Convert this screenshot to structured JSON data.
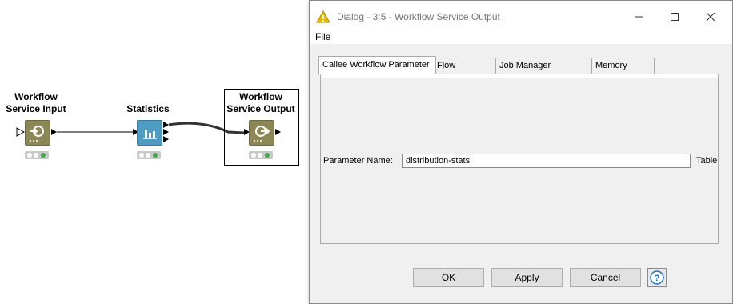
{
  "canvas": {
    "nodes": [
      {
        "title_line1": "Workflow",
        "title_line2": "Service Input",
        "icon": "workflow-input-icon"
      },
      {
        "title_line1": "",
        "title_line2": "Statistics",
        "icon": "statistics-icon"
      },
      {
        "title_line1": "Workflow",
        "title_line2": "Service Output",
        "icon": "workflow-output-icon"
      }
    ]
  },
  "dialog": {
    "title": "Dialog - 3:5 - Workflow Service Output",
    "menu": [
      "File"
    ],
    "tabs": [
      "Callee Workflow Parameter",
      "Flow Variables",
      "Job Manager Selection",
      "Memory Policy"
    ],
    "active_tab": "Callee Workflow Parameter",
    "param_label": "Parameter Name:",
    "param_value": "distribution-stats",
    "side_label": "Table",
    "buttons": {
      "ok": "OK",
      "apply": "Apply",
      "cancel": "Cancel",
      "help": "?"
    }
  },
  "colors": {
    "node_olive": "#8b8756",
    "node_blue": "#4e9cc2",
    "status_green": "#3fae3f",
    "warning_yellow": "#e8b800",
    "help_blue": "#1e6fc2"
  }
}
